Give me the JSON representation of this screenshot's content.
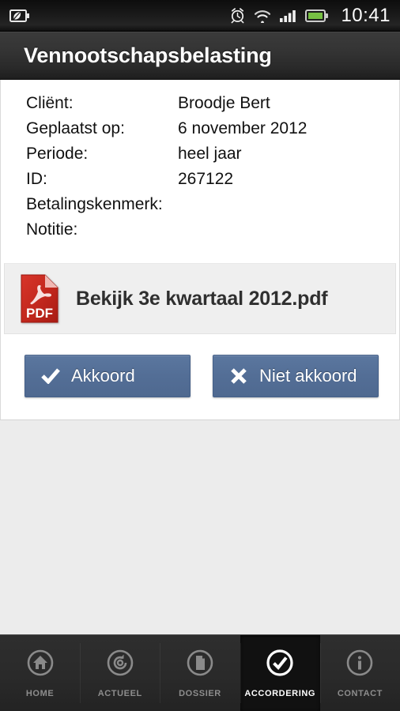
{
  "statusbar": {
    "time": "10:41",
    "left_icons": [
      {
        "name": "battery-eco-icon",
        "label": "eco battery"
      }
    ],
    "right_icons": [
      {
        "name": "alarm-clock-icon",
        "label": "alarm"
      },
      {
        "name": "wifi-icon",
        "label": "wifi"
      },
      {
        "name": "signal-bars-icon",
        "label": "signal"
      },
      {
        "name": "battery-icon",
        "label": "battery",
        "color": "#77c043"
      }
    ]
  },
  "header": {
    "title": "Vennootschapsbelasting"
  },
  "details": [
    {
      "label": "Cliënt:",
      "value": "Broodje Bert"
    },
    {
      "label": "Geplaatst op:",
      "value": "6 november 2012"
    },
    {
      "label": "Periode:",
      "value": "heel jaar"
    },
    {
      "label": "ID:",
      "value": "267122"
    },
    {
      "label": "Betalingskenmerk:",
      "value": ""
    },
    {
      "label": "Notitie:",
      "value": ""
    }
  ],
  "attachment": {
    "icon": "pdf-file-icon",
    "icon_badge": "PDF",
    "label": "Bekijk 3e kwartaal 2012.pdf"
  },
  "actions": [
    {
      "name": "approve-button",
      "icon": "check-icon",
      "label": "Akkoord",
      "color": "#536e96"
    },
    {
      "name": "reject-button",
      "icon": "cross-icon",
      "label": "Niet akkoord",
      "color": "#536e96"
    }
  ],
  "tabbar": [
    {
      "name": "tab-home",
      "icon": "home-icon",
      "label": "HOME",
      "active": false
    },
    {
      "name": "tab-actueel",
      "icon": "refresh-spiral-icon",
      "label": "ACTUEEL",
      "active": false
    },
    {
      "name": "tab-dossier",
      "icon": "document-icon",
      "label": "DOSSIER",
      "active": false
    },
    {
      "name": "tab-accordering",
      "icon": "check-circle-icon",
      "label": "ACCORDERING",
      "active": true
    },
    {
      "name": "tab-contact",
      "icon": "info-icon",
      "label": "CONTACT",
      "active": false
    }
  ],
  "colors": {
    "accent": "#536e96",
    "page_background": "#ececec",
    "card_background": "#ffffff",
    "attachment_background": "#efefef",
    "titlebar": "#2e2e2e",
    "pdf_red": "#c1271d"
  }
}
